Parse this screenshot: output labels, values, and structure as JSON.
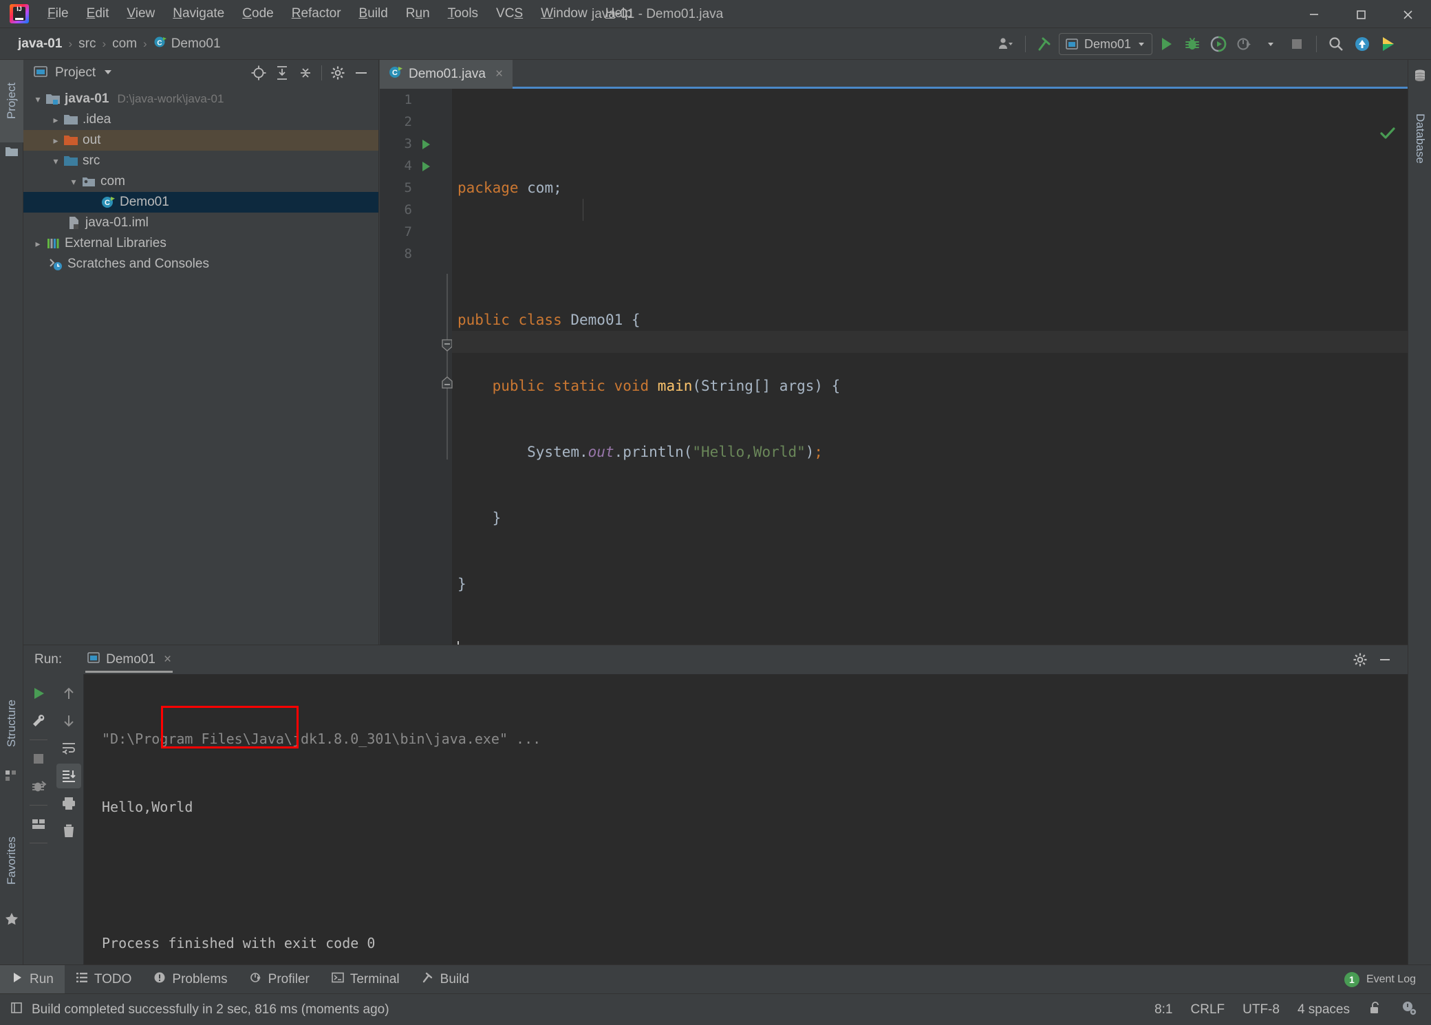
{
  "window": {
    "title": "java-01 - Demo01.java",
    "minimize_label": "Minimize",
    "maximize_label": "Maximize",
    "close_label": "Close"
  },
  "menubar": {
    "items": [
      {
        "label": "File",
        "mnemonic": "F"
      },
      {
        "label": "Edit",
        "mnemonic": "E"
      },
      {
        "label": "View",
        "mnemonic": "V"
      },
      {
        "label": "Navigate",
        "mnemonic": "N"
      },
      {
        "label": "Code",
        "mnemonic": "C"
      },
      {
        "label": "Refactor",
        "mnemonic": "R"
      },
      {
        "label": "Build",
        "mnemonic": "B"
      },
      {
        "label": "Run",
        "mnemonic": "u"
      },
      {
        "label": "Tools",
        "mnemonic": "T"
      },
      {
        "label": "VCS",
        "mnemonic": "S"
      },
      {
        "label": "Window",
        "mnemonic": "W"
      },
      {
        "label": "Help",
        "mnemonic": "H"
      }
    ]
  },
  "navbar": {
    "breadcrumbs": [
      "java-01",
      "src",
      "com",
      "Demo01"
    ],
    "separator": "›",
    "run_config": "Demo01",
    "icons": [
      "user-icon",
      "build-hammer-icon",
      "run-icon",
      "debug-icon",
      "run-with-coverage-icon",
      "profile-icon",
      "stop-icon",
      "search-everywhere-icon",
      "update-project-icon",
      "ide-assistant-icon"
    ]
  },
  "left_strip": {
    "tabs": [
      {
        "label": "Project",
        "icon": "folder-icon",
        "active": true
      },
      {
        "label": "Structure",
        "icon": "structure-icon",
        "active": false
      },
      {
        "label": "Favorites",
        "icon": "star-icon",
        "active": false
      }
    ]
  },
  "right_strip": {
    "tabs": [
      {
        "label": "Database",
        "icon": "database-icon",
        "active": false
      }
    ]
  },
  "project_panel": {
    "title": "Project",
    "header_icons": [
      "locate-icon",
      "expand-all-icon",
      "collapse-all-icon",
      "settings-gear-icon",
      "hide-icon"
    ],
    "tree": [
      {
        "label": "java-01",
        "sub": "D:\\java-work\\java-01",
        "indent": 0,
        "arrow": "down",
        "icon": "module-folder-icon",
        "bold": true,
        "state": "none"
      },
      {
        "label": ".idea",
        "sub": "",
        "indent": 1,
        "arrow": "right",
        "icon": "folder-icon",
        "bold": false,
        "state": "none"
      },
      {
        "label": "out",
        "sub": "",
        "indent": 1,
        "arrow": "right",
        "icon": "output-folder-icon",
        "bold": false,
        "state": "dim-selected"
      },
      {
        "label": "src",
        "sub": "",
        "indent": 1,
        "arrow": "down",
        "icon": "source-folder-icon",
        "bold": false,
        "state": "none"
      },
      {
        "label": "com",
        "sub": "",
        "indent": 2,
        "arrow": "down",
        "icon": "package-icon",
        "bold": false,
        "state": "none"
      },
      {
        "label": "Demo01",
        "sub": "",
        "indent": 3,
        "arrow": "none",
        "icon": "java-class-icon",
        "bold": false,
        "state": "selected"
      },
      {
        "label": "java-01.iml",
        "sub": "",
        "indent": 1,
        "arrow": "none",
        "icon": "iml-file-icon",
        "bold": false,
        "state": "none"
      },
      {
        "label": "External Libraries",
        "sub": "",
        "indent": 0,
        "arrow": "right",
        "icon": "libraries-icon",
        "bold": false,
        "state": "none"
      },
      {
        "label": "Scratches and Consoles",
        "sub": "",
        "indent": 0,
        "arrow": "none",
        "icon": "scratches-icon",
        "bold": false,
        "state": "none"
      }
    ]
  },
  "editor": {
    "tab": {
      "label": "Demo01.java",
      "icon": "java-class-icon",
      "close": "×"
    },
    "inspection_status": "ok",
    "lines": [
      {
        "num": "1",
        "gutter_run": false,
        "tokens": [
          {
            "t": "package ",
            "c": "kw"
          },
          {
            "t": "com;",
            "c": "id"
          }
        ],
        "indent": 0
      },
      {
        "num": "2",
        "gutter_run": false,
        "tokens": [],
        "indent": 0
      },
      {
        "num": "3",
        "gutter_run": true,
        "tokens": [
          {
            "t": "public class ",
            "c": "kw"
          },
          {
            "t": "Demo01 {",
            "c": "id"
          }
        ],
        "indent": 0
      },
      {
        "num": "4",
        "gutter_run": true,
        "tokens": [
          {
            "t": "    public static void ",
            "c": "kw"
          },
          {
            "t": "main",
            "c": "mth"
          },
          {
            "t": "(String[] args) {",
            "c": "id"
          }
        ],
        "indent": 1
      },
      {
        "num": "5",
        "gutter_run": false,
        "tokens": [
          {
            "t": "        System.",
            "c": "id"
          },
          {
            "t": "out",
            "c": "fld"
          },
          {
            "t": ".println(",
            "c": "id"
          },
          {
            "t": "\"Hello,World\"",
            "c": "str"
          },
          {
            "t": ")",
            "c": "id"
          },
          {
            "t": ";",
            "c": "kw"
          }
        ],
        "indent": 2
      },
      {
        "num": "6",
        "gutter_run": false,
        "tokens": [
          {
            "t": "    }",
            "c": "id"
          }
        ],
        "indent": 1
      },
      {
        "num": "7",
        "gutter_run": false,
        "tokens": [
          {
            "t": "}",
            "c": "id"
          }
        ],
        "indent": 0
      },
      {
        "num": "8",
        "gutter_run": false,
        "tokens": [],
        "indent": 0
      }
    ]
  },
  "run_panel": {
    "label": "Run:",
    "tab": "Demo01",
    "tab_close": "×",
    "header_icons": [
      "settings-gear-icon",
      "hide-icon"
    ],
    "left_tools": [
      "rerun-icon",
      "edit-configuration-icon",
      "stop-icon",
      "dump-threads-icon",
      "layout-icon"
    ],
    "right_tools": [
      "up-arrow-icon",
      "down-arrow-icon",
      "soft-wrap-icon",
      "scroll-to-end-icon",
      "print-icon",
      "clear-all-icon"
    ],
    "console": {
      "command": "\"D:\\Program Files\\Java\\jdk1.8.0_301\\bin\\java.exe\" ...",
      "output": "Hello,World",
      "blank": "",
      "exit": "Process finished with exit code 0"
    },
    "highlight_color": "#ff0000"
  },
  "toolwindow_bar": {
    "items": [
      {
        "label": "Run",
        "icon": "run-icon",
        "active": true
      },
      {
        "label": "TODO",
        "icon": "todo-icon",
        "active": false
      },
      {
        "label": "Problems",
        "icon": "problems-icon",
        "active": false
      },
      {
        "label": "Profiler",
        "icon": "profiler-icon",
        "active": false
      },
      {
        "label": "Terminal",
        "icon": "terminal-icon",
        "active": false
      },
      {
        "label": "Build",
        "icon": "build-hammer-icon",
        "active": false
      }
    ],
    "event_log": {
      "label": "Event Log",
      "count": "1"
    }
  },
  "statusbar": {
    "message": "Build completed successfully in 2 sec, 816 ms (moments ago)",
    "message_icon": "book-icon",
    "caret_position": "8:1",
    "line_separator": "CRLF",
    "encoding": "UTF-8",
    "indent": "4 spaces",
    "lock_icon": "unlocked-icon",
    "ide_icon": "ide-settings-icon"
  },
  "colors": {
    "accent": "#4a88c7",
    "selection": "#0d293e",
    "editor_bg": "#2b2b2b",
    "panel_bg": "#3c3f41",
    "keyword": "#cc7832",
    "string": "#6a8759",
    "method": "#ffc66d",
    "field": "#9876aa",
    "green": "#499c54"
  }
}
